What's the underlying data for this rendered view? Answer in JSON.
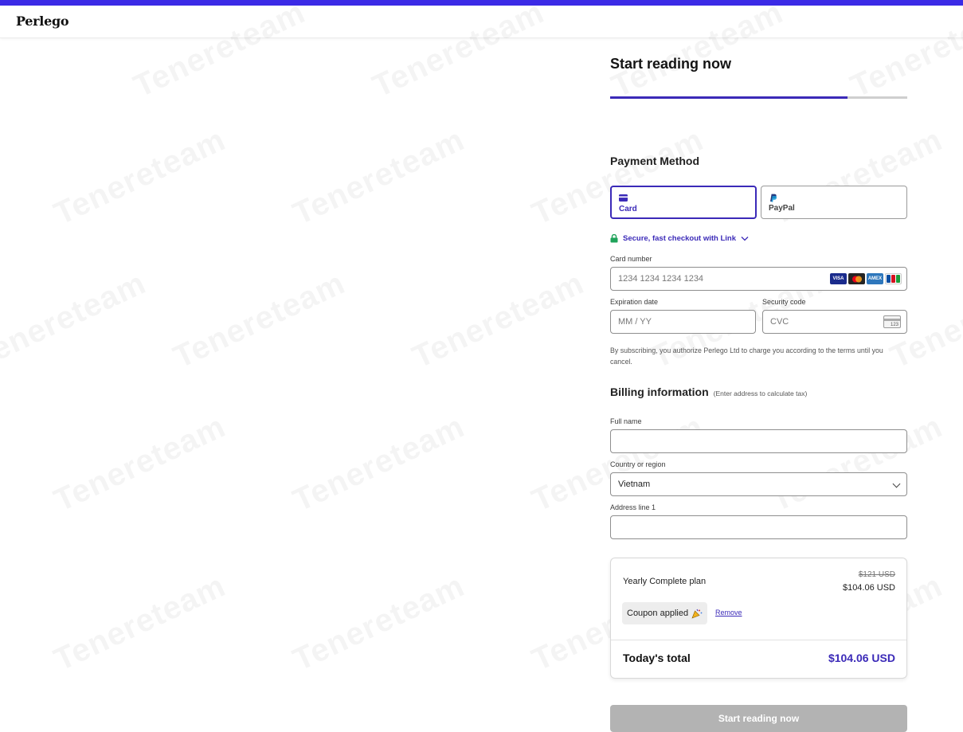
{
  "brand": {
    "logo": "Perlego",
    "accent": "#3b2ab8",
    "topbar": "#3b2ae6"
  },
  "watermark": "Tenereteam",
  "checkout": {
    "title": "Start reading now",
    "progress": 0.8
  },
  "payment": {
    "heading": "Payment Method",
    "methods": [
      {
        "label": "Card",
        "icon": "card-icon",
        "selected": true
      },
      {
        "label": "PayPal",
        "icon": "paypal-icon",
        "selected": false
      }
    ],
    "link_text": "Secure, fast checkout with Link",
    "card_number_label": "Card number",
    "card_number_placeholder": "1234 1234 1234 1234",
    "card_brands": [
      "VISA",
      "mastercard",
      "AMEX",
      "JCB"
    ],
    "expiry_label": "Expiration date",
    "expiry_placeholder": "MM / YY",
    "cvc_label": "Security code",
    "cvc_placeholder": "CVC",
    "cvc_icon_text": "123",
    "authorization_note": "By subscribing, you authorize Perlego Ltd to charge you according to the terms until you cancel."
  },
  "billing": {
    "heading": "Billing information",
    "hint": "(Enter address to calculate tax)",
    "full_name_label": "Full name",
    "full_name_value": "",
    "country_label": "Country or region",
    "country_value": "Vietnam",
    "address_label": "Address line 1",
    "address_value": ""
  },
  "summary": {
    "plan": "Yearly Complete plan",
    "original_price": "$121 USD",
    "discounted_price": "$104.06 USD",
    "coupon_label": "Coupon applied",
    "remove_label": "Remove",
    "total_label": "Today's total",
    "total_value": "$104.06 USD"
  },
  "submit_label": "Start reading now"
}
